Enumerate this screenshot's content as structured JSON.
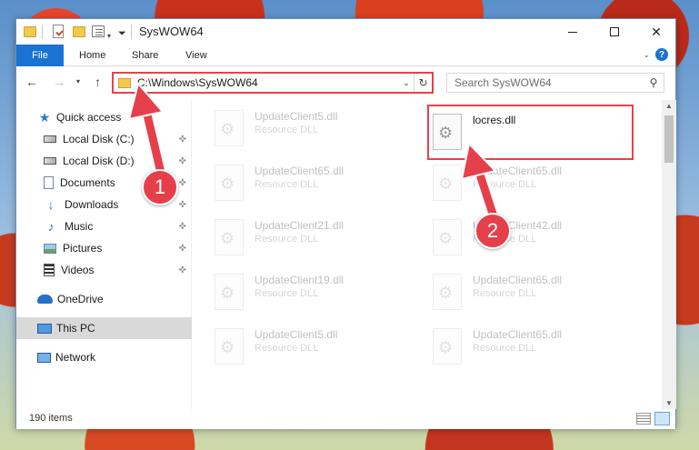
{
  "window": {
    "title": "SysWOW64"
  },
  "ribbon": {
    "file": "File",
    "home": "Home",
    "share": "Share",
    "view": "View"
  },
  "address": {
    "path": "C:\\Windows\\SysWOW64"
  },
  "search": {
    "placeholder": "Search SysWOW64"
  },
  "sidebar": {
    "items": [
      {
        "label": "Quick access"
      },
      {
        "label": "Local Disk (C:)"
      },
      {
        "label": "Local Disk (D:)"
      },
      {
        "label": "Documents"
      },
      {
        "label": "Downloads"
      },
      {
        "label": "Music"
      },
      {
        "label": "Pictures"
      },
      {
        "label": "Videos"
      },
      {
        "label": "OneDrive"
      },
      {
        "label": "This PC"
      },
      {
        "label": "Network"
      }
    ]
  },
  "files": [
    {
      "name": "UpdateClient5.dll",
      "type": "Resource DLL"
    },
    {
      "name": "locres.dll",
      "type": ""
    },
    {
      "name": "UpdateClient65.dll",
      "type": "Resource DLL"
    },
    {
      "name": "UpdateClient65.dll",
      "type": "Resource DLL"
    },
    {
      "name": "UpdateClient21.dll",
      "type": "Resource DLL"
    },
    {
      "name": "UpdateClient42.dll",
      "type": "Resource DLL"
    },
    {
      "name": "UpdateClient19.dll",
      "type": "Resource DLL"
    },
    {
      "name": "UpdateClient65.dll",
      "type": "Resource DLL"
    },
    {
      "name": "UpdateClient5.dll",
      "type": "Resource DLL"
    },
    {
      "name": "UpdateClient65.dll",
      "type": "Resource DLL"
    }
  ],
  "status": {
    "count": "190 items"
  },
  "annotations": {
    "step1": "1",
    "step2": "2",
    "accent_color": "#e5404a"
  }
}
